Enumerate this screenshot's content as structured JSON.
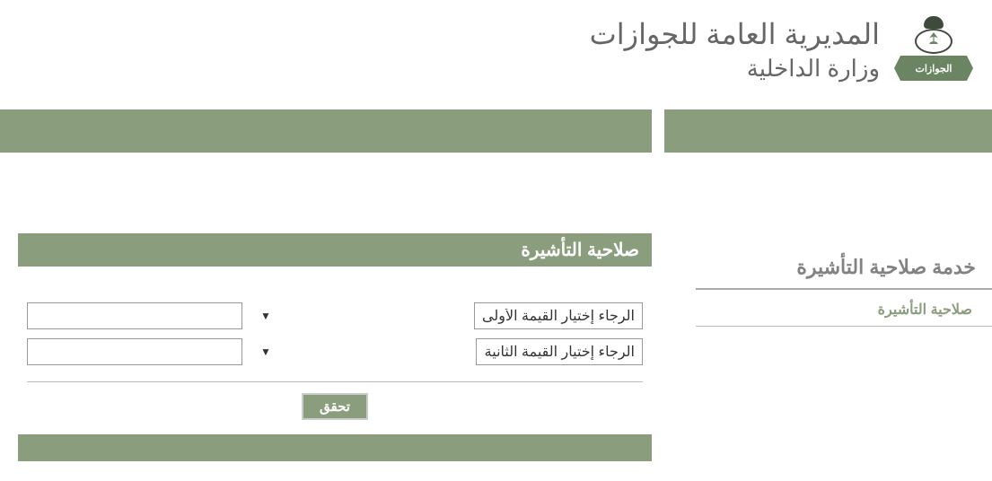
{
  "header": {
    "title_main": "المديرية العامة للجوازات",
    "title_sub": "وزارة الداخلية",
    "logo_banner_text": "الجوازات"
  },
  "sidebar": {
    "title": "خدمة صلاحية التأشيرة",
    "link": "صلاحية التأشيرة"
  },
  "form": {
    "title": "صلاحية التأشيرة",
    "select1_placeholder": "الرجاء إختيار القيمة الأولى",
    "select2_placeholder": "الرجاء إختيار القيمة الثانية",
    "input1_value": "",
    "input2_value": "",
    "verify_label": "تحقق"
  },
  "colors": {
    "olive": "#8a9e7e",
    "gray_text": "#666666"
  }
}
